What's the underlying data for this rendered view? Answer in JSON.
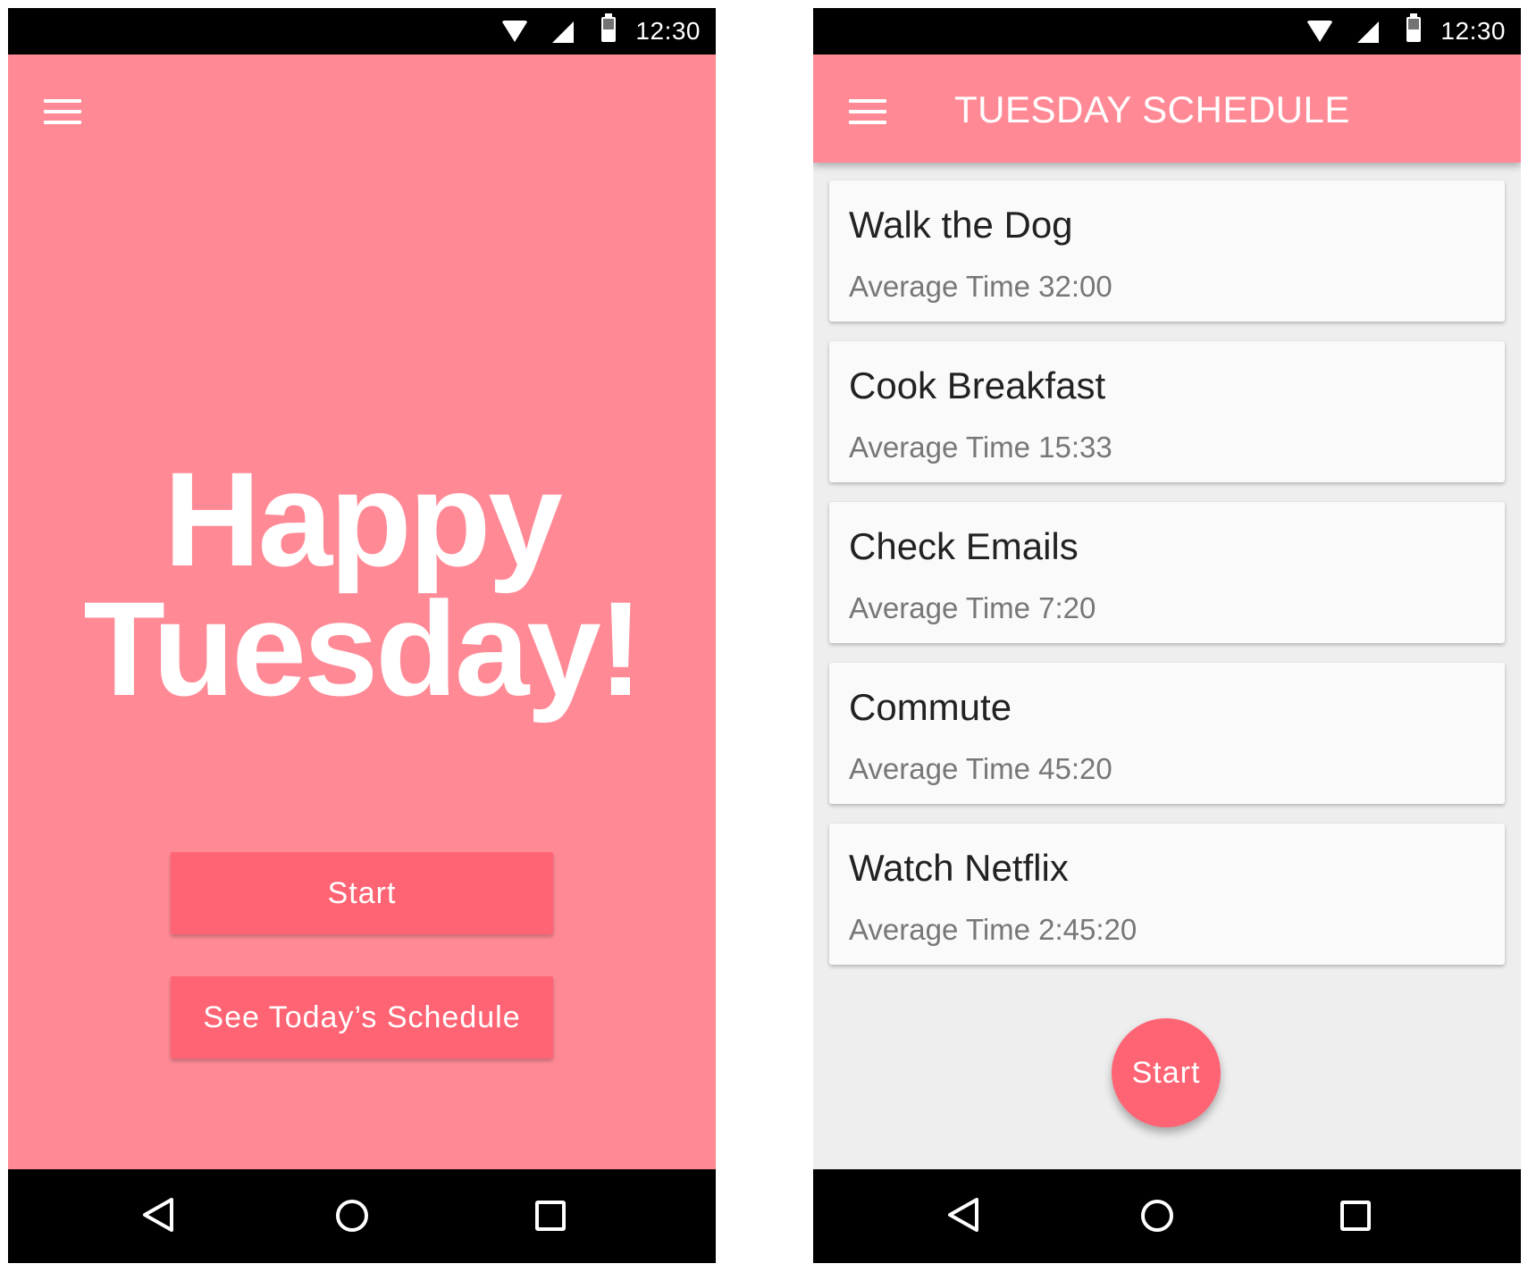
{
  "status_bar": {
    "time": "12:30"
  },
  "home_screen": {
    "greeting_line1": "Happy",
    "greeting_line2": "Tuesday!",
    "start_label": "Start",
    "schedule_label": "See Today’s Schedule"
  },
  "schedule_screen": {
    "title": "TUESDAY SCHEDULE",
    "items": [
      {
        "title": "Walk the Dog",
        "subtitle": "Average Time 32:00"
      },
      {
        "title": "Cook Breakfast",
        "subtitle": "Average Time 15:33"
      },
      {
        "title": "Check Emails",
        "subtitle": "Average Time 7:20"
      },
      {
        "title": "Commute",
        "subtitle": "Average Time 45:20"
      },
      {
        "title": "Watch Netflix",
        "subtitle": "Average Time 2:45:20"
      }
    ],
    "fab_label": "Start"
  },
  "colors": {
    "background_pink": "#ff8a96",
    "accent_pink": "#ff6474",
    "card_background": "#fafafa",
    "list_background": "#eeeeee"
  },
  "icons": [
    "wifi-icon",
    "signal-icon",
    "battery-icon",
    "menu-icon",
    "back-icon",
    "home-icon",
    "recents-icon"
  ]
}
